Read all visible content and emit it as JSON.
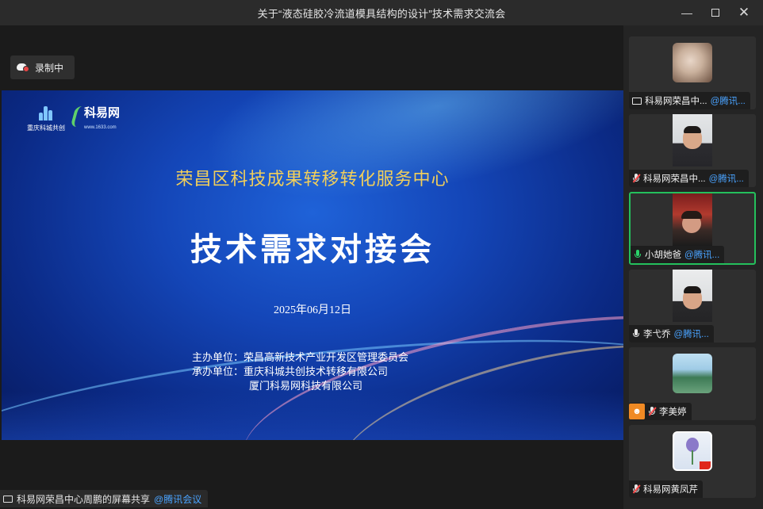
{
  "window": {
    "title": "关于“液态硅胶冷流道模具结构的设计”技术需求交流会",
    "controls": [
      "minimize",
      "maximize",
      "close"
    ]
  },
  "recording": {
    "label": "录制中",
    "icon": "cloud-record-icon",
    "dot_color": "#e84545"
  },
  "slide": {
    "logo_left_text": "重庆科城共创",
    "logo_right_text": "科易网",
    "logo_right_url": "www.1633.com",
    "subtitle": "荣昌区科技成果转移转化服务中心",
    "title": "技术需求对接会",
    "date": "2025年06月12日",
    "organizers": [
      {
        "label": "主办单位：",
        "name": "荣昌高新技术产业开发区管理委员会"
      },
      {
        "label": "承办单位：",
        "name": "重庆科城共创技术转移有限公司"
      },
      {
        "label": "",
        "name": "厦门科易网科技有限公司"
      }
    ],
    "colors": {
      "subtitle": "#f2cf5a",
      "background": "#1446b8"
    }
  },
  "share_status": {
    "text": "科易网荣昌中心周鹏的屏幕共享",
    "tag": "@腾讯会议"
  },
  "participants": [
    {
      "name": "科易网荣昌中...",
      "tag": "@腾讯...",
      "status_icon": "screen-share-icon",
      "active": false,
      "media": "photo"
    },
    {
      "name": "科易网荣昌中...",
      "tag": "@腾讯...",
      "status_icon": "mic-muted-icon",
      "active": false,
      "media": "video"
    },
    {
      "name": "小胡她爸",
      "tag": "@腾讯...",
      "status_icon": "mic-on-icon",
      "active": true,
      "media": "video"
    },
    {
      "name": "李弋乔",
      "tag": "@腾讯...",
      "status_icon": "mic-icon",
      "active": false,
      "media": "video"
    },
    {
      "name": "李美婷",
      "tag": "",
      "status_icon": "mic-muted-icon",
      "active": false,
      "media": "photo"
    },
    {
      "name": "科易网黄凤芹",
      "tag": "",
      "status_icon": "mic-muted-icon",
      "active": false,
      "media": "photo"
    }
  ],
  "accent": {
    "active_border": "#24c05c",
    "link": "#4aa3ff"
  }
}
